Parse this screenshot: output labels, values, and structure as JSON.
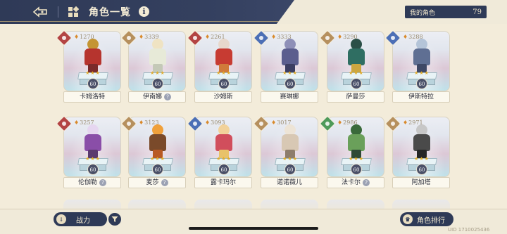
{
  "header": {
    "title": "角色一覧",
    "my_characters_label": "我的角色",
    "my_characters_count": "79"
  },
  "characters": [
    {
      "name": "卡姆洛特",
      "power": "1270",
      "level": "60",
      "stars": "★★★",
      "class_icon": "sword-class-icon",
      "class_color": "#b34444",
      "palette": [
        "#c49534",
        "#b6342e",
        "#7a2a2a"
      ],
      "has_tag": false
    },
    {
      "name": "伊南娜",
      "power": "3339",
      "level": "60",
      "stars": "★★★",
      "class_icon": "magic-class-icon",
      "class_color": "#b6905e",
      "palette": [
        "#efe3c3",
        "#e7ead8",
        "#c4c9b7"
      ],
      "has_tag": true
    },
    {
      "name": "沙姆斯",
      "power": "2261",
      "level": "60",
      "stars": "★★★",
      "class_icon": "sword-class-icon",
      "class_color": "#b34444",
      "palette": [
        "#e7d8cc",
        "#c73b32",
        "#d07a3a"
      ],
      "has_tag": false
    },
    {
      "name": "赛琳娜",
      "power": "3333",
      "level": "60",
      "stars": "★★★",
      "class_icon": "cross-class-icon",
      "class_color": "#4c6fb6",
      "palette": [
        "#8e90b8",
        "#5b5e8e",
        "#3c3e62"
      ],
      "has_tag": false
    },
    {
      "name": "萨曼莎",
      "power": "3290",
      "level": "60",
      "stars": "★★★",
      "class_icon": "magic-class-icon",
      "class_color": "#b6905e",
      "palette": [
        "#2b4f47",
        "#2f6e62",
        "#cba640"
      ],
      "has_tag": false
    },
    {
      "name": "伊斯特拉",
      "power": "3288",
      "level": "60",
      "stars": "★★★",
      "class_icon": "cross-class-icon",
      "class_color": "#4c6fb6",
      "palette": [
        "#b4c4d8",
        "#5f6f93",
        "#3e4866"
      ],
      "has_tag": false
    },
    {
      "name": "伦伽勒",
      "power": "3257",
      "level": "60",
      "stars": "★★★",
      "class_icon": "sword-class-icon",
      "class_color": "#b34444",
      "palette": [
        "#e6d6f0",
        "#8a4ea8",
        "#5b3a6e"
      ],
      "has_tag": true
    },
    {
      "name": "麦莎",
      "power": "3123",
      "level": "60",
      "stars": "★★★",
      "class_icon": "magic-class-icon",
      "class_color": "#b6905e",
      "palette": [
        "#f0a03a",
        "#7a4a2a",
        "#b85a22"
      ],
      "has_tag": true
    },
    {
      "name": "露卡玛尔",
      "power": "3093",
      "level": "60",
      "stars": "★★★",
      "class_icon": "cross-class-icon",
      "class_color": "#4c6fb6",
      "palette": [
        "#f2d29a",
        "#d14e5c",
        "#e8c26a"
      ],
      "has_tag": false
    },
    {
      "name": "诺诺薇儿",
      "power": "3017",
      "level": "60",
      "stars": "★★★",
      "class_icon": "magic-class-icon",
      "class_color": "#b6905e",
      "palette": [
        "#ede4d6",
        "#d8c8b4",
        "#8e7d6c"
      ],
      "has_tag": false
    },
    {
      "name": "法卡尔",
      "power": "2986",
      "level": "60",
      "stars": "★★★",
      "class_icon": "leaf-class-icon",
      "class_color": "#4e9a5a",
      "palette": [
        "#3a6a3a",
        "#6aa05a",
        "#2f4a36"
      ],
      "has_tag": true
    },
    {
      "name": "阿加塔",
      "power": "2971",
      "level": "60",
      "stars": "★★★",
      "class_icon": "magic-class-icon",
      "class_color": "#b6905e",
      "palette": [
        "#c7c7c7",
        "#4a4a4a",
        "#262626"
      ],
      "has_tag": false
    }
  ],
  "footer": {
    "sort_label": "战力",
    "sort_icon_text": "↓",
    "rank_label": "角色排行",
    "rank_icon_text": "♛",
    "uid": "UID 1710025436"
  },
  "tag_glyph": "?"
}
